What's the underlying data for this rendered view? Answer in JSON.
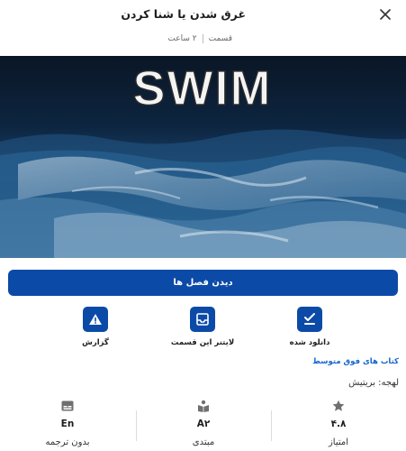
{
  "header": {
    "title": "غرق شدن یا شنا کردن",
    "episode_label": "قسمت",
    "duration": "۲ ساعت"
  },
  "cover": {
    "text": "SWIM",
    "colors": {
      "sky": "#0a1c33",
      "water": "#1e4c78",
      "foam": "#bcd4e6"
    }
  },
  "primary_action": {
    "label": "دیدن فصل ها"
  },
  "actions": [
    {
      "label": "دانلود شده",
      "icon": "check-list-icon"
    },
    {
      "label": "لایتنر این قسمت",
      "icon": "inbox-tray-icon"
    },
    {
      "label": "گزارش",
      "icon": "warning-icon"
    }
  ],
  "related_link": "کتاب های فوق متوسط",
  "dialect": "لهجه: بریتیش",
  "stats": [
    {
      "value": "۴.۸",
      "label": "امتیاز",
      "icon": "star-icon"
    },
    {
      "value": "A۲",
      "label": "مبتدی",
      "icon": "reading-person-icon"
    },
    {
      "value": "En",
      "label": "بدون ترجمه",
      "icon": "subtitles-icon"
    }
  ],
  "colors": {
    "accent": "#0c4aa8",
    "link": "#1766c9"
  }
}
